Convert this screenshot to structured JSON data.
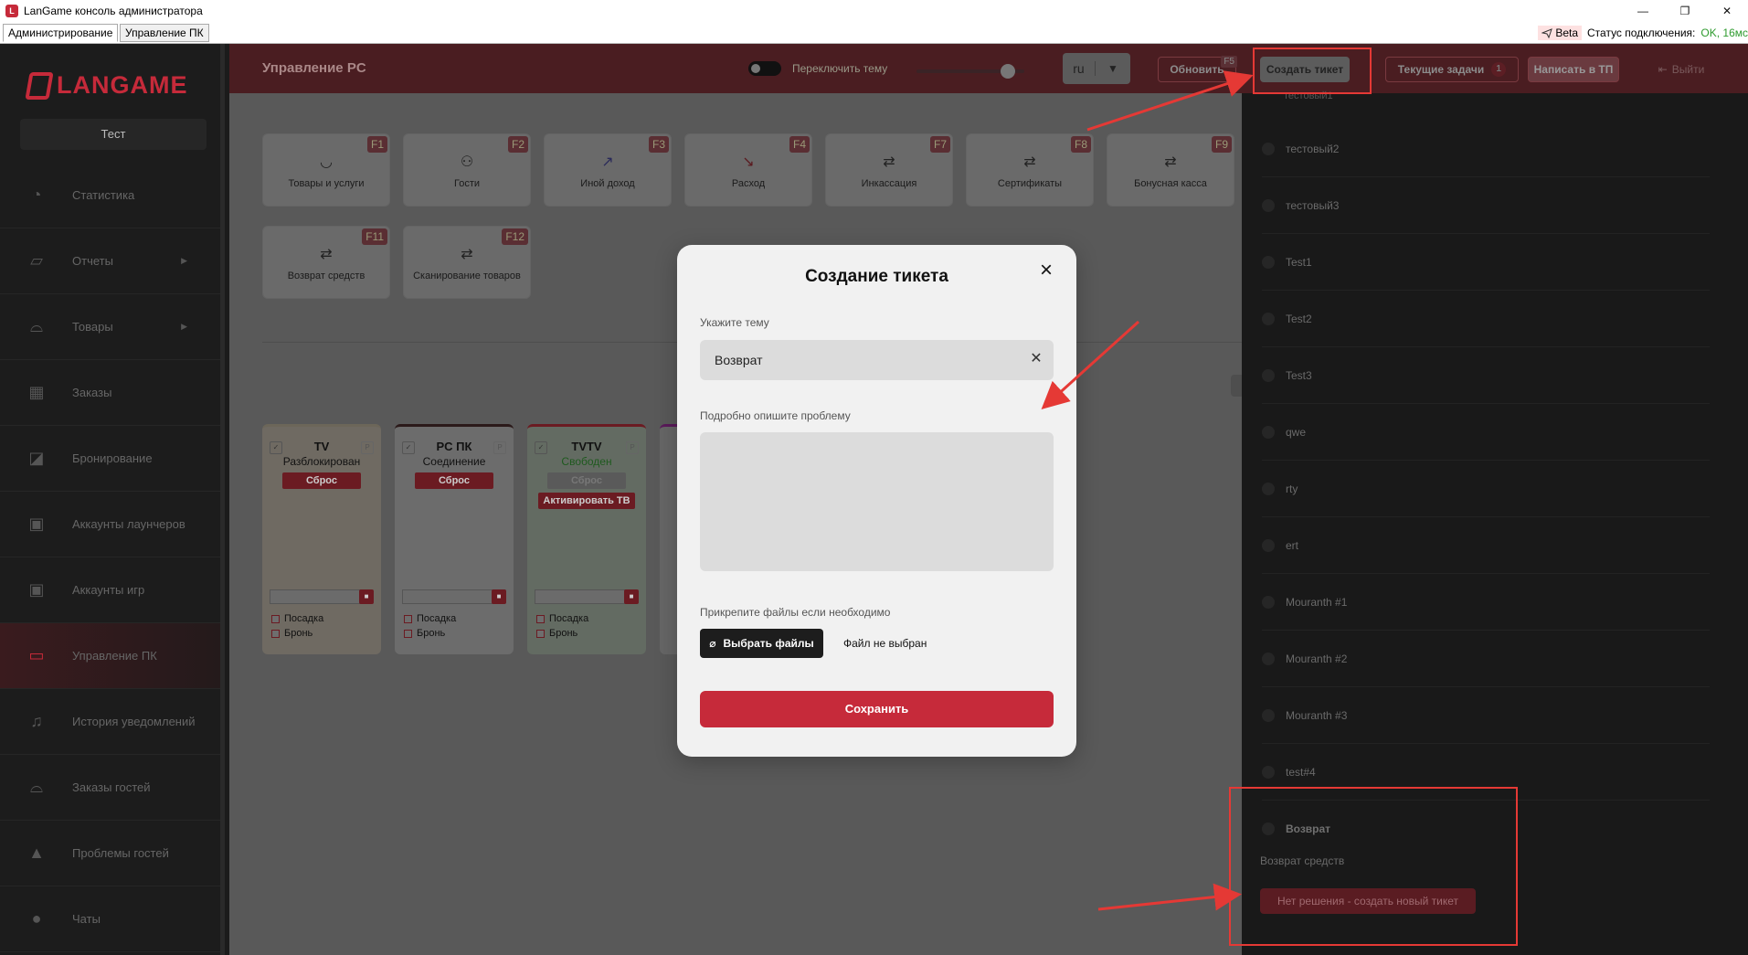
{
  "window": {
    "title": "LanGame консоль администратора",
    "minimize": "—",
    "restore": "❐",
    "close": "✕"
  },
  "menubar": {
    "tab_admin": "Администрирование",
    "tab_pc": "Управление ПК",
    "beta": "Beta",
    "status_label": "Статус подключения:",
    "status_value": "OK, 16мс"
  },
  "sidebar": {
    "logo": "LANGAME",
    "club": "Тест",
    "items": [
      {
        "label": "Статистика"
      },
      {
        "label": "Отчеты"
      },
      {
        "label": "Товары"
      },
      {
        "label": "Заказы"
      },
      {
        "label": "Бронирование"
      },
      {
        "label": "Аккаунты лаунчеров"
      },
      {
        "label": "Аккаунты игр"
      },
      {
        "label": "Управление ПК"
      },
      {
        "label": "История уведомлений"
      },
      {
        "label": "Заказы гостей"
      },
      {
        "label": "Проблемы гостей"
      },
      {
        "label": "Чаты"
      }
    ]
  },
  "header": {
    "title": "Управление PC",
    "theme_toggle": "Переключить тему",
    "lang": "ru",
    "refresh": "Обновить",
    "refresh_key": "F5",
    "create_ticket": "Создать тикет",
    "current_tasks": "Текущие задачи",
    "tasks_count": "1",
    "support": "Написать в ТП",
    "logout": "Выйти"
  },
  "tiles": [
    {
      "label": "Товары и услуги",
      "key": "F1",
      "icon": "bowl-icon"
    },
    {
      "label": "Гости",
      "key": "F2",
      "icon": "users-icon"
    },
    {
      "label": "Иной доход",
      "key": "F3",
      "icon": "trend-up-icon"
    },
    {
      "label": "Расход",
      "key": "F4",
      "icon": "trend-down-icon"
    },
    {
      "label": "Инкассация",
      "key": "F7",
      "icon": "cash-exchange-icon"
    },
    {
      "label": "Сертификаты",
      "key": "F8",
      "icon": "cash-exchange-icon"
    },
    {
      "label": "Бонусная касса",
      "key": "F9",
      "icon": "cash-exchange-icon"
    },
    {
      "label": "Возврат средств",
      "key": "F11",
      "icon": "cash-exchange-icon"
    },
    {
      "label": "Сканирование товаров",
      "key": "F12",
      "icon": "cash-exchange-icon"
    }
  ],
  "pcs": [
    {
      "name": "TV",
      "status": "Разблокирован",
      "reset": "Сброс",
      "boarding": "Посадка",
      "booking": "Бронь"
    },
    {
      "name": "PC ПК",
      "status": "Соединение",
      "reset": "Сброс",
      "boarding": "Посадка",
      "booking": "Бронь"
    },
    {
      "name": "TVTV",
      "status": "Свободен",
      "reset": "Сброс",
      "activate": "Активировать ТВ",
      "boarding": "Посадка",
      "booking": "Бронь"
    }
  ],
  "pc_check_mark": "✓",
  "pc_p": "P",
  "pc_save_icon": "■",
  "tasks_panel": {
    "items": [
      "тестовый2",
      "тестовый3",
      "Test1",
      "Test2",
      "Test3",
      "qwe",
      "rty",
      "ert",
      "Mouranth #1",
      "Mouranth #2",
      "Mouranth #3",
      "test#4",
      "Возврат"
    ],
    "open_subject": "Возврат средств",
    "new_ticket": "Нет решения - создать новый тикет"
  },
  "modal": {
    "title": "Создание тикета",
    "subject_label": "Укажите тему",
    "subject_value": "Возврат",
    "description_label": "Подробно опишите проблему",
    "files_label": "Прикрепите файлы если необходимо",
    "choose_files": "Выбрать файлы",
    "no_file": "Файл не выбран",
    "save": "Сохранить"
  },
  "colors": {
    "accent": "#c62a3a",
    "annotation": "#e53935"
  }
}
